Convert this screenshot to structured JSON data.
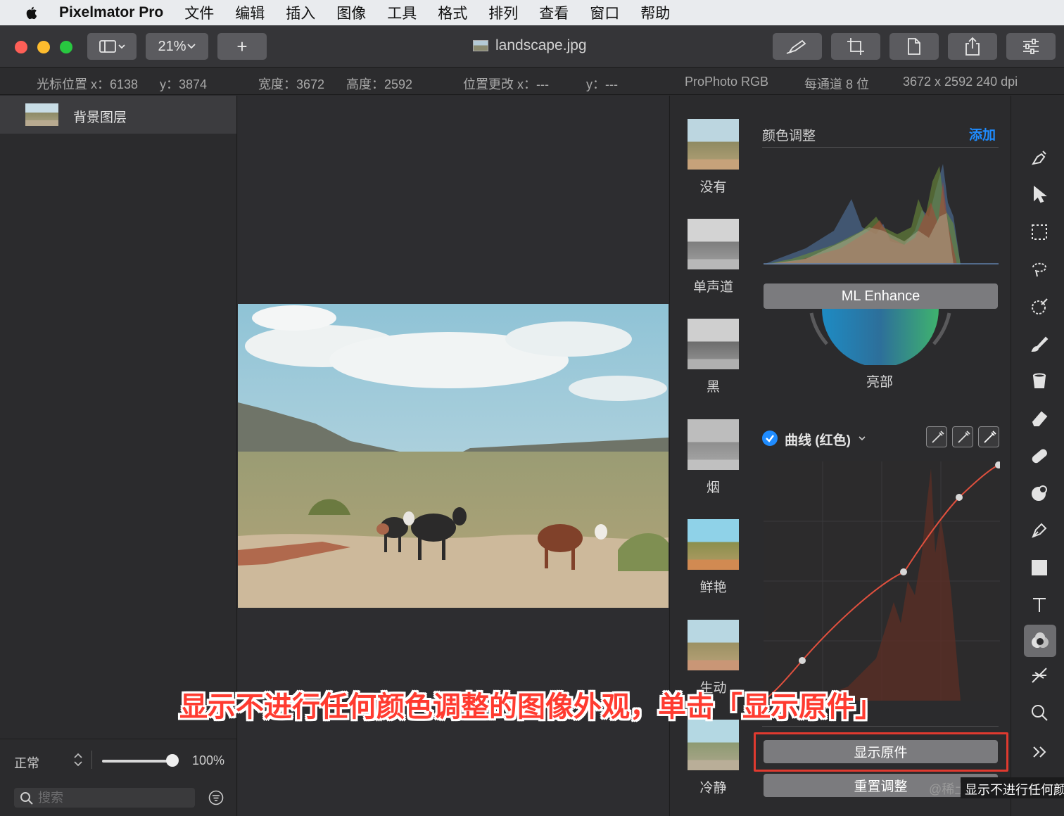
{
  "menubar": {
    "app_name": "Pixelmator Pro",
    "items": [
      "文件",
      "编辑",
      "插入",
      "图像",
      "工具",
      "格式",
      "排列",
      "查看",
      "窗口",
      "帮助"
    ]
  },
  "toolbar": {
    "zoom": "21%",
    "add_symbol": "+",
    "document_title": "landscape.jpg"
  },
  "infobar": {
    "cursor_x": "光标位置 x：6138",
    "cursor_y": "y：3874",
    "width": "宽度：3672",
    "height": "高度：2592",
    "pos_change_x": "位置更改 x：---",
    "pos_change_y": "y：---",
    "color_profile": "ProPhoto RGB",
    "bit_depth": "每通道 8 位",
    "dimensions": "3672 x 2592 240 dpi"
  },
  "layers": {
    "items": [
      {
        "name": "背景图层"
      }
    ],
    "blend_mode": "正常",
    "opacity": "100%",
    "opacity_fraction": 1.0,
    "search_placeholder": "搜索"
  },
  "presets": [
    "没有",
    "单声道",
    "黑",
    "烟",
    "鲜艳",
    "生动",
    "冷静"
  ],
  "adjustments": {
    "section_title": "颜色调整",
    "add_label": "添加",
    "ml_enhance": "ML Enhance",
    "wheel_label": "亮部",
    "curves_title": "曲线 (红色)",
    "show_original": "显示原件",
    "reset": "重置调整"
  },
  "overlay": {
    "caption": "显示不进行任何颜色调整的图像外观，单击「显示原件」",
    "watermark": "@稀土掘金技术社区",
    "tooltip_fragment": "显示不进行任何颜"
  },
  "colors": {
    "accent": "#1f8cff",
    "highlight_box": "#e03a2f",
    "caption": "#ff3b30",
    "close": "#fe5f57",
    "minimize": "#febc2e",
    "zoom": "#28c840"
  }
}
